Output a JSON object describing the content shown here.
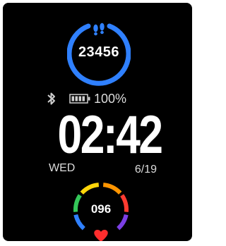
{
  "steps": {
    "value": "23456",
    "ring_color": "#2f80ff",
    "icon": "footprints-icon"
  },
  "status": {
    "bluetooth_icon": "bluetooth-icon",
    "battery_icon": "battery-icon",
    "battery_percent": "100%"
  },
  "clock": {
    "time": "02:42",
    "weekday": "WED",
    "date": "6/19"
  },
  "heart_rate": {
    "value": "096",
    "icon": "heart-icon",
    "ring_colors": [
      "#ff3b30",
      "#ff9500",
      "#ffd60a",
      "#34c759",
      "#2f80ff",
      "#7b3fe4"
    ]
  }
}
